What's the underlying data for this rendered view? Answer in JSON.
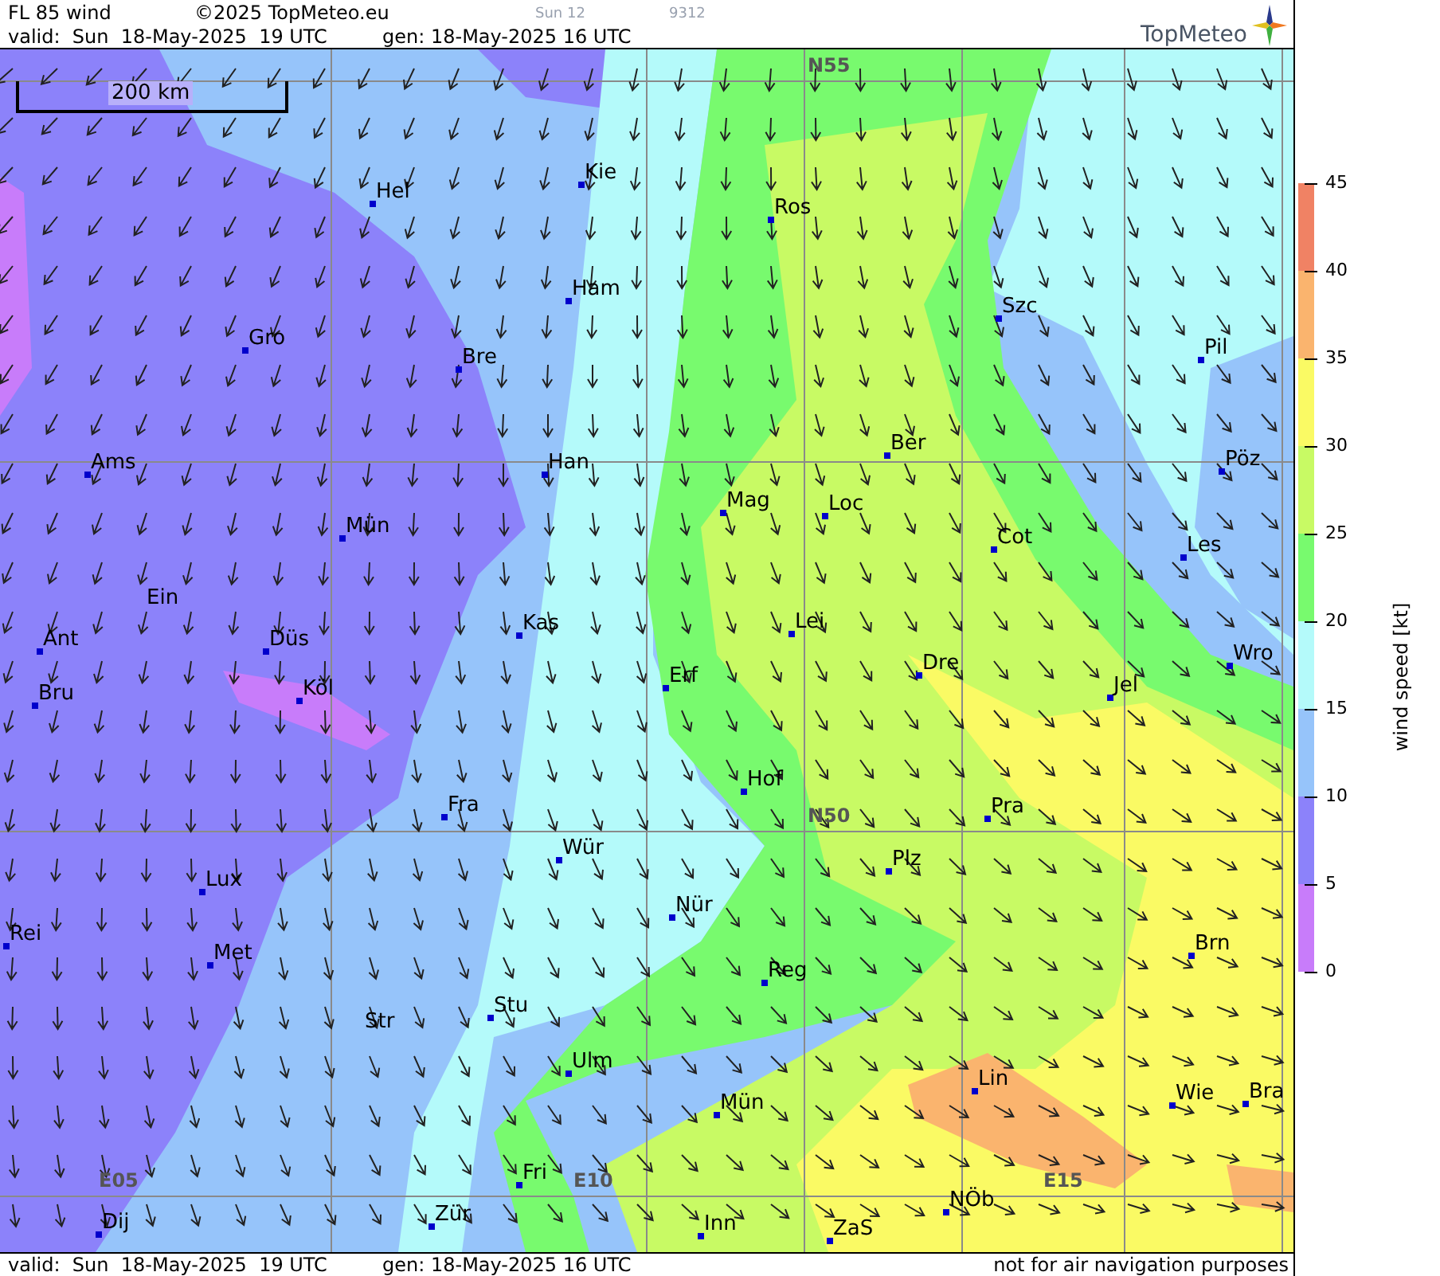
{
  "header": {
    "title": "FL 85 wind",
    "copyright": "©2025 TopMeteo.eu",
    "code_1": "Sun 12",
    "code_2": "9312",
    "valid": "valid:  Sun  18-May-2025  19 UTC",
    "generated": "gen: 18-May-2025 16 UTC",
    "logo": "TopMeteo"
  },
  "map": {
    "scale_bar": "200 km",
    "grid_labels": [
      "N55",
      "N50",
      "E05",
      "E10",
      "E15"
    ],
    "cities": [
      "Hel",
      "Kie",
      "Ros",
      "Ham",
      "Gro",
      "Bre",
      "Szc",
      "Pil",
      "Ams",
      "Han",
      "Ber",
      "Pöz",
      "Mag",
      "Loc",
      "Mün",
      "Cot",
      "Les",
      "Ein",
      "Kas",
      "Lei",
      "Ant",
      "Düs",
      "Dre",
      "Wro",
      "Bru",
      "Köl",
      "Erf",
      "Jel",
      "Hof",
      "Fra",
      "Pra",
      "Wür",
      "Plz",
      "Lux",
      "Nür",
      "Rei",
      "Met",
      "Brn",
      "Reg",
      "Stu",
      "Str",
      "Ulm",
      "Lin",
      "Wie",
      "Bra",
      "Mün",
      "Fri",
      "NÖb",
      "Zür",
      "Dij",
      "Inn",
      "ZaS"
    ]
  },
  "legend": {
    "title": "wind speed [kt]",
    "ticks": [
      "45",
      "40",
      "35",
      "30",
      "25",
      "20",
      "15",
      "10",
      "5",
      "0"
    ],
    "bands": [
      {
        "color": "#f08264"
      },
      {
        "color": "#fab46e"
      },
      {
        "color": "#fafa64"
      },
      {
        "color": "#c8fa64"
      },
      {
        "color": "#78fa6e"
      },
      {
        "color": "#b4fafa"
      },
      {
        "color": "#96c4fa"
      },
      {
        "color": "#8c82fa"
      },
      {
        "color": "#c87cfa"
      }
    ]
  },
  "footer": {
    "valid": "valid:  Sun  18-May-2025  19 UTC",
    "generated": "gen: 18-May-2025 16 UTC",
    "note": "not for air navigation purposes"
  }
}
